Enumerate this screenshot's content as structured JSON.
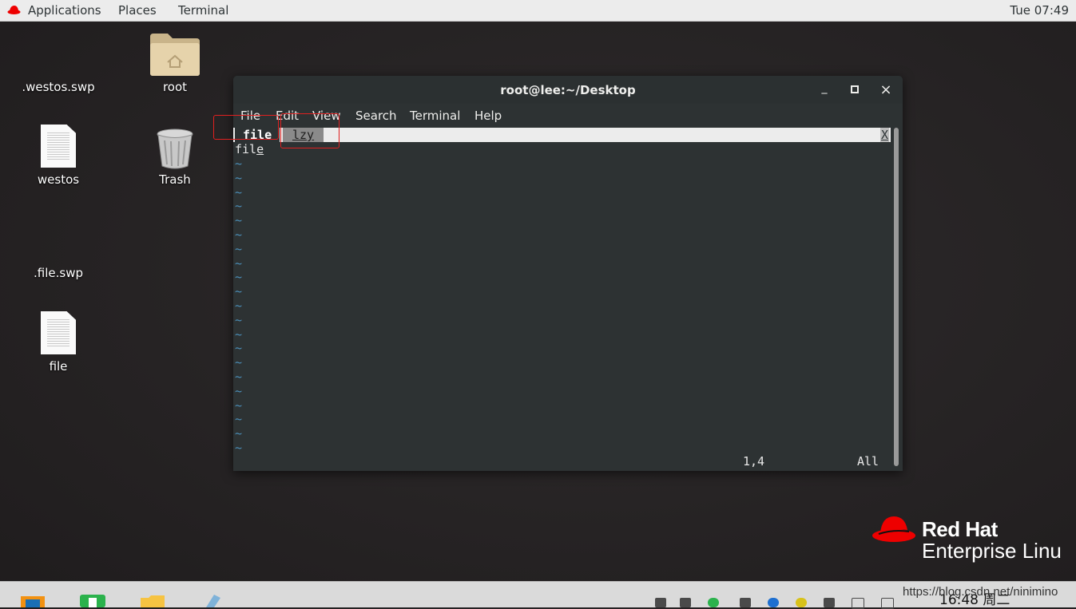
{
  "topbar": {
    "applications": "Applications",
    "places": "Places",
    "terminal": "Terminal",
    "clock": "Tue 07:49"
  },
  "desktop": {
    "icons": [
      {
        "label": ".westos.swp"
      },
      {
        "label": "root"
      },
      {
        "label": "westos"
      },
      {
        "label": "Trash"
      },
      {
        "label": ".file.swp"
      },
      {
        "label": "file"
      }
    ]
  },
  "terminal": {
    "title": "root@lee:~/Desktop",
    "minimize": "_",
    "maximize": "▫",
    "close": "×",
    "menu": [
      "File",
      "Edit",
      "View",
      "Search",
      "Terminal",
      "Help"
    ],
    "vim": {
      "tab_active": "file",
      "tab_other": "lzy",
      "tab_close": "X",
      "line1_prefix": "fil",
      "line1_cursor": "e",
      "tilde": "~",
      "ruler_pos": "1,4",
      "ruler_all": "All"
    }
  },
  "logo": {
    "title": "Red Hat",
    "subtitle": "Enterprise Linu"
  },
  "taskbar": {
    "clock": "16:48 周二",
    "watermark": "https://blog.csdn.net/ninimino"
  },
  "colors": {
    "annotation": "#e02020",
    "redhat": "#ee0000",
    "tilde": "#4b8eb8"
  }
}
